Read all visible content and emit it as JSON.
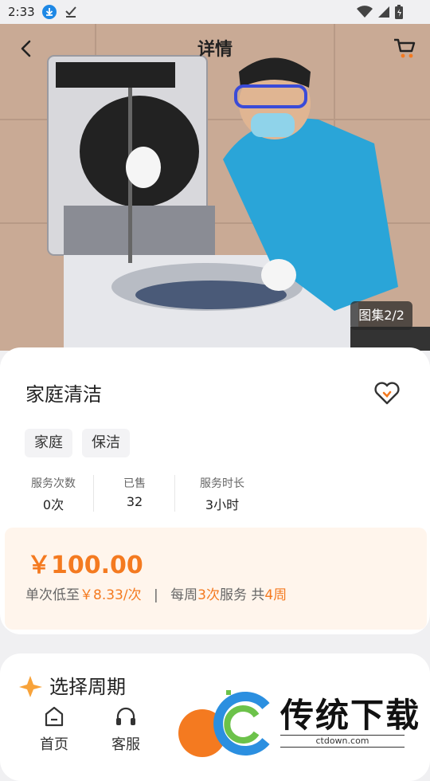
{
  "status_bar": {
    "time": "2:33"
  },
  "nav": {
    "title": "详情"
  },
  "gallery": {
    "badge": "图集2/2"
  },
  "service": {
    "title": "家庭清洁",
    "tags": [
      "家庭",
      "保洁"
    ],
    "stats": [
      {
        "label": "服务次数",
        "value": "0次"
      },
      {
        "label": "已售",
        "value": "32"
      },
      {
        "label": "服务时长",
        "value": "3小时"
      }
    ]
  },
  "price": {
    "main": "￥100.00",
    "per_prefix": "单次低至",
    "per_value": "￥8.33/次",
    "separator": "|",
    "weekly_prefix": "每周",
    "weekly_count": "3次",
    "weekly_mid": "服务 共",
    "weekly_weeks": "4周"
  },
  "section": {
    "title": "选择周期"
  },
  "tabs": [
    {
      "label": "首页",
      "icon": "home-icon"
    },
    {
      "label": "客服",
      "icon": "headset-icon"
    }
  ],
  "watermark": {
    "text": "传统下载",
    "url": "ctdown.com"
  },
  "colors": {
    "accent": "#f47a20",
    "price_bg": "#fff5ec"
  }
}
